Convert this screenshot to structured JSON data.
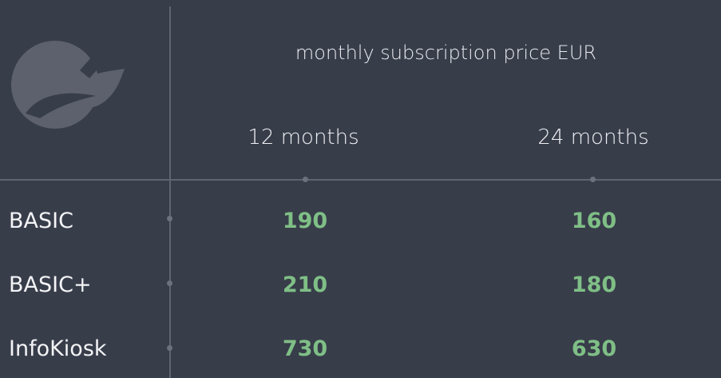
{
  "header": {
    "title": "monthly subscription price EUR",
    "columns": [
      "12 months",
      "24 months"
    ]
  },
  "rows": [
    {
      "label": "BASIC",
      "prices": [
        "190",
        "160"
      ]
    },
    {
      "label": "BASIC+",
      "prices": [
        "210",
        "180"
      ]
    },
    {
      "label": "InfoKiosk",
      "prices": [
        "730",
        "630"
      ]
    }
  ],
  "logo": {
    "icon": "leaf-plug-icon"
  },
  "colors": {
    "background": "#383d4a",
    "price": "#7fbf86",
    "text": "#f1f2f4",
    "lines": "#5f6470"
  }
}
